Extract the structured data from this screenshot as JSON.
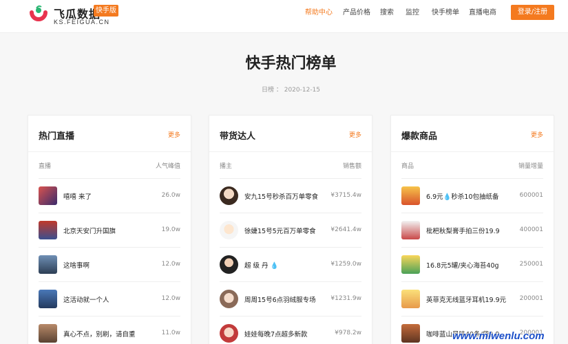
{
  "header": {
    "logo_title": "飞瓜数据",
    "logo_badge": "快手版",
    "logo_sub": "KS.FEIGUA.CN",
    "nav": [
      "帮助中心",
      "产品价格",
      "搜索",
      "监控",
      "快手榜单",
      "直播电商"
    ],
    "active_nav": "帮助中心",
    "login_label": "登录/注册",
    "accent_color": "#f47a1f"
  },
  "page": {
    "title": "快手热门榜单",
    "date_label": "日榜",
    "date_value": "2020-12-15"
  },
  "cards": [
    {
      "title": "热门直播",
      "more": "更多",
      "col_left": "直播",
      "col_right": "人气峰值",
      "rows": [
        {
          "name": "嘻嘻 来了",
          "value": "26.0w"
        },
        {
          "name": "北京天安门升国旗",
          "value": "19.0w"
        },
        {
          "name": "这啥事啊",
          "value": "12.0w"
        },
        {
          "name": "这活动就一个人",
          "value": "12.0w"
        },
        {
          "name": "真心不点，别刷，请自重",
          "value": "11.0w"
        }
      ]
    },
    {
      "title": "带货达人",
      "more": "更多",
      "col_left": "播主",
      "col_right": "销售额",
      "rows": [
        {
          "name": "安九15号秒杀百万单零食",
          "value": "¥3715.4w"
        },
        {
          "name": "徐婕15号5元百万单零食",
          "value": "¥2641.4w"
        },
        {
          "name": "超 级 丹 💧",
          "value": "¥1259.0w"
        },
        {
          "name": "周周15号6点羽绒服专场",
          "value": "¥1231.9w"
        },
        {
          "name": "娃娃每晚7点超多新款",
          "value": "¥978.2w"
        }
      ]
    },
    {
      "title": "爆款商品",
      "more": "更多",
      "col_left": "商品",
      "col_right": "销量增量",
      "rows": [
        {
          "name": "6.9元💧秒杀10包抽纸备",
          "value": "600001"
        },
        {
          "name": "枇杷秋梨膏手拍三份19.9",
          "value": "400001"
        },
        {
          "name": "16.8元5罐/夹心海苔40g",
          "value": "250001"
        },
        {
          "name": "英菲克无线蓝牙耳机19.9元",
          "value": "200001"
        },
        {
          "name": "咖啡蓝山风味40条/袋9.9",
          "value": "200001"
        }
      ]
    }
  ],
  "watermark": "www.mlwenlu.com"
}
